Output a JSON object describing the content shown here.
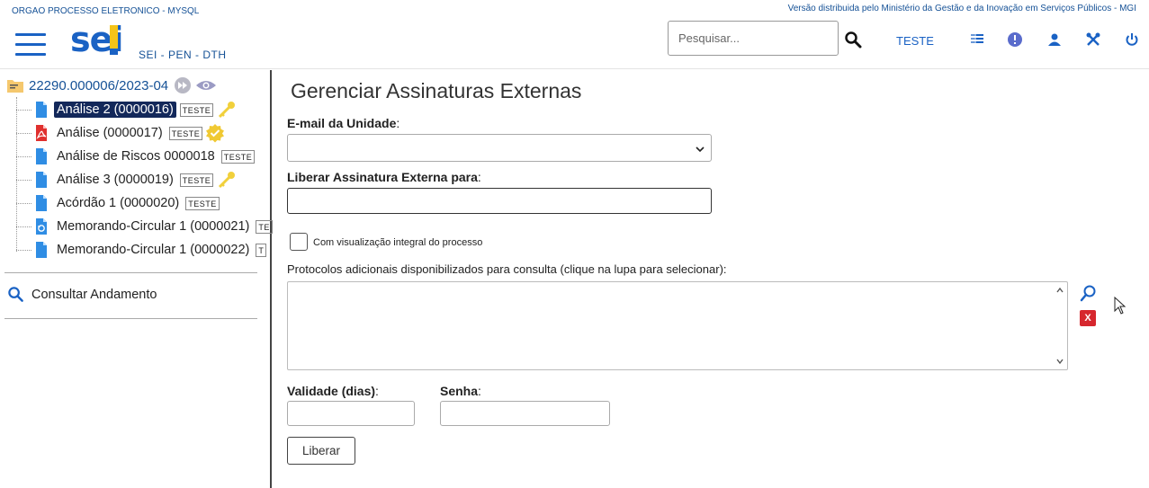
{
  "header": {
    "org_name": "ORGAO PROCESSO ELETRONICO - MYSQL",
    "version_text": "Versão distribuida pelo Ministério da Gestão e da Inovação em Serviços Públicos - MGI",
    "logo_text": "sei",
    "subtitle": "SEI - PEN - DTH",
    "search_placeholder": "Pesquisar...",
    "unit": "TESTE",
    "icons": [
      "search-icon",
      "menu-list-icon",
      "info-icon",
      "user-icon",
      "tools-icon",
      "power-icon"
    ]
  },
  "sidebar": {
    "process_number": "22290.000006/2023-04",
    "documents": [
      {
        "label": "Análise 2 (0000016)",
        "badge": "TESTE",
        "icon": "document-icon",
        "marker": "key-icon",
        "selected": true
      },
      {
        "label": "Análise (0000017)",
        "badge": "TESTE",
        "icon": "pdf-icon",
        "marker": "signed-icon",
        "selected": false
      },
      {
        "label": "Análise de Riscos 0000018",
        "badge": "TESTE",
        "icon": "document-icon",
        "marker": "",
        "selected": false
      },
      {
        "label": "Análise 3 (0000019)",
        "badge": "TESTE",
        "icon": "document-icon",
        "marker": "key-icon",
        "selected": false
      },
      {
        "label": "Acórdão 1 (0000020)",
        "badge": "TESTE",
        "icon": "document-icon",
        "marker": "",
        "selected": false
      },
      {
        "label": "Memorando-Circular 1 (0000021)",
        "badge": "TE",
        "icon": "circular-document-icon",
        "marker": "",
        "selected": false
      },
      {
        "label": "Memorando-Circular 1 (0000022)",
        "badge": "T",
        "icon": "document-icon",
        "marker": "",
        "selected": false
      }
    ],
    "consult_label": "Consultar Andamento"
  },
  "main": {
    "title": "Gerenciar Assinaturas Externas",
    "email_label": "E-mail da Unidade",
    "email_value": "",
    "liberar_label": "Liberar Assinatura Externa para",
    "liberar_value": "",
    "checkbox_label": "Com visualização integral do processo",
    "checkbox_checked": false,
    "protocols_label": "Protocolos adicionais disponibilizados para consulta (clique na lupa para selecionar):",
    "validade_label": "Validade (dias)",
    "validade_value": "",
    "senha_label": "Senha",
    "senha_value": "",
    "button_label": "Liberar",
    "remove_label": "X"
  },
  "colors": {
    "brand_blue": "#1a62c4",
    "logo_yellow": "#f5c418",
    "selected_bg": "#13285a",
    "remove_red": "#d6272e"
  }
}
